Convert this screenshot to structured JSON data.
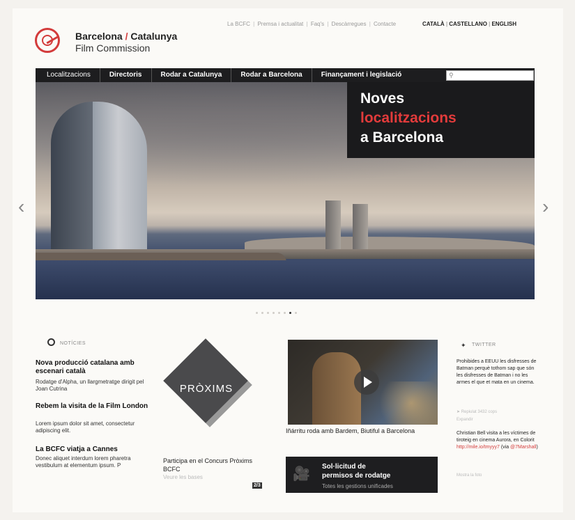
{
  "logo": {
    "line1_a": "Barcelona",
    "line1_sep": " / ",
    "line1_b": "Catalunya",
    "line2": "Film Commission"
  },
  "top_links": [
    "La BCFC",
    "Premsa i actualitat",
    "Faq's",
    "Descàrregues",
    "Contacte"
  ],
  "languages": [
    "CATALÀ",
    "CASTELLANO",
    "ENGLISH"
  ],
  "nav": [
    "Localitzacions",
    "Directoris",
    "Rodar a Catalunya",
    "Rodar a Barcelona",
    "Finançament i legislació"
  ],
  "search": {
    "placeholder": ""
  },
  "hero": {
    "line1": "Noves",
    "line2": "localitzacions",
    "line3": "a Barcelona",
    "slide_count": 8,
    "active_slide": 6
  },
  "news": {
    "heading": "NOTÍCIES",
    "items": [
      {
        "title": "Nova producció catalana amb escenari català",
        "text": "Rodatge d'Alpha, un llargmetratge dirigit pel Joan Cutrina"
      },
      {
        "title": "Rebem la visita de la Film London",
        "text": "Lorem ipsum dolor sit amet, consectetur adipiscing elit."
      },
      {
        "title": "La BCFC viatja a Cannes",
        "text": "Donec aliquet interdum lorem pharetra vestibulum at elementum ipsum. P"
      }
    ]
  },
  "proxims": {
    "label": "PRÒXIMS",
    "title": "Participa en el Concurs Pròxims BCFC",
    "link": "Veure les bases",
    "pager": "2/3"
  },
  "video": {
    "caption": "Iñárritu roda amb Bardem, Biutiful a Barcelona"
  },
  "permits": {
    "line1": "Sol·licitud de",
    "line2": "permisos de rodatge",
    "line3": "Totes les gestions unificades"
  },
  "twitter": {
    "heading": "TWITTER",
    "tweet1": "Prohibides a EEUU les disfresses de Batman perquè tothom sap que són les disfresses de Batman i no les armes el que et mata en un cinema.",
    "tweet1_meta": "Repiulat 3432 cops",
    "tweet1_expand": "Expandir",
    "tweet2": "Christian Bell visita a les víctimes de tiroteig en cinema Aurora, en Colorit",
    "tweet2_link": "http://mile.io/tmyyy7",
    "tweet2_via_pre": "(via",
    "tweet2_handle": "@7Marshall",
    "tweet2_via_post": ")",
    "tweet2_more": "Mostra la foto"
  }
}
